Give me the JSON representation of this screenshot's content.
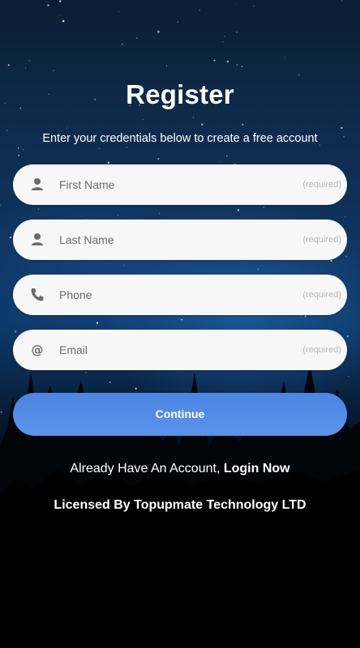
{
  "header": {
    "title": "Register",
    "subtitle": "Enter your credentials below to create a free account"
  },
  "form": {
    "fields": [
      {
        "icon": "person-icon",
        "placeholder": "First Name",
        "hint": "(required)"
      },
      {
        "icon": "person-icon",
        "placeholder": "Last Name",
        "hint": "(required)"
      },
      {
        "icon": "phone-icon",
        "placeholder": "Phone",
        "hint": "(required)"
      },
      {
        "icon": "at-sign-icon",
        "placeholder": "Email",
        "hint": "(required)"
      }
    ],
    "continue_label": "Continue"
  },
  "footer": {
    "login_prompt": "Already Have An Account,",
    "login_link": "Login Now",
    "license": "Licensed By Topupmate Technology LTD"
  },
  "colors": {
    "button": "#4c86e4",
    "field_bg": "#f7f7f8",
    "icon": "#6b6b6b"
  }
}
